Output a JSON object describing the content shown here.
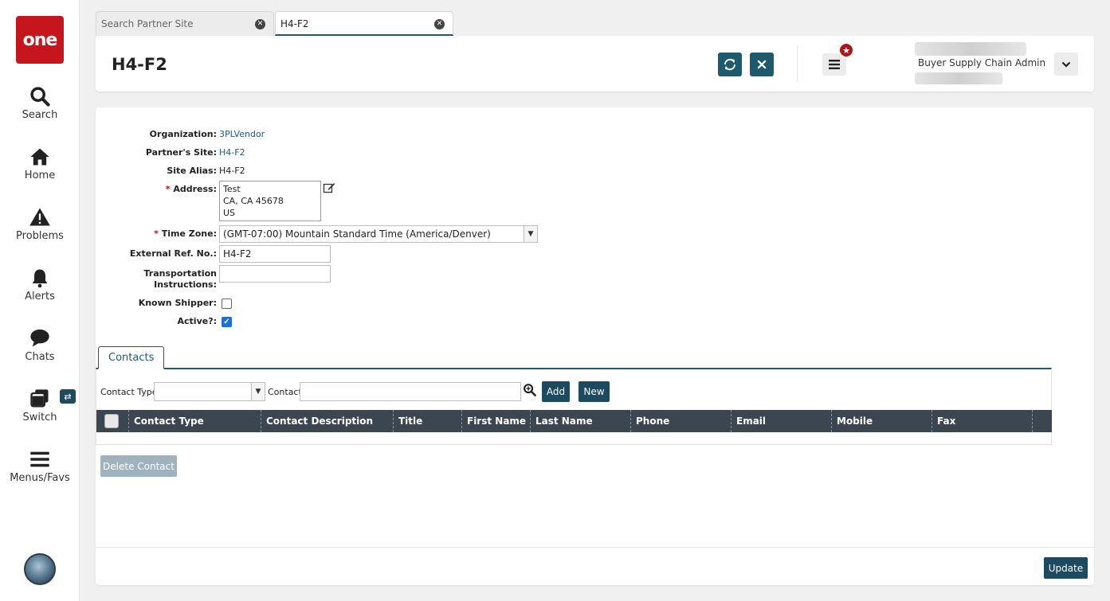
{
  "app": {
    "logo_text": "one",
    "brand_color": "#c4161c",
    "accent_color": "#1e5a6e"
  },
  "sidebar": {
    "items": [
      {
        "label": "Search",
        "icon": "search-icon"
      },
      {
        "label": "Home",
        "icon": "home-icon"
      },
      {
        "label": "Problems",
        "icon": "warning-icon"
      },
      {
        "label": "Alerts",
        "icon": "bell-icon"
      },
      {
        "label": "Chats",
        "icon": "chat-icon"
      },
      {
        "label": "Switch",
        "icon": "switch-icon"
      },
      {
        "label": "Menus/Favs",
        "icon": "menu-icon"
      }
    ],
    "switch_badge": "⇄"
  },
  "tabs": [
    {
      "label": "Search Partner Site",
      "active": false
    },
    {
      "label": "H4-F2",
      "active": true
    }
  ],
  "header": {
    "title": "H4-F2",
    "user_role": "Buyer Supply Chain Admin"
  },
  "form": {
    "organization": {
      "label": "Organization:",
      "value": "3PLVendor"
    },
    "partner_site": {
      "label": "Partner's Site:",
      "value": "H4-F2"
    },
    "site_alias": {
      "label": "Site Alias:",
      "value": "H4-F2"
    },
    "address": {
      "label": "Address:",
      "lines": [
        "Test",
        "CA, CA 45678",
        "US"
      ]
    },
    "time_zone": {
      "label": "Time Zone:",
      "value": "(GMT-07:00) Mountain Standard Time (America/Denver)"
    },
    "external_ref": {
      "label": "External Ref. No.:",
      "value": "H4-F2"
    },
    "transport_instr": {
      "label_line1": "Transportation",
      "label_line2": "Instructions:",
      "value": ""
    },
    "known_shipper": {
      "label": "Known Shipper:",
      "checked": false
    },
    "active": {
      "label": "Active?:",
      "checked": true
    },
    "required_mark": "*"
  },
  "contacts": {
    "tab_label": "Contacts",
    "filter_contact_type_label": "Contact Type",
    "filter_contact_type_value": "",
    "filter_contact_label": "Contact",
    "filter_contact_value": "",
    "add_label": "Add",
    "new_label": "New",
    "columns": [
      "Contact Type",
      "Contact Description",
      "Title",
      "First Name",
      "Last Name",
      "Phone",
      "Email",
      "Mobile",
      "Fax"
    ],
    "rows": [],
    "delete_label": "Delete Contact"
  },
  "footer": {
    "update_label": "Update"
  }
}
